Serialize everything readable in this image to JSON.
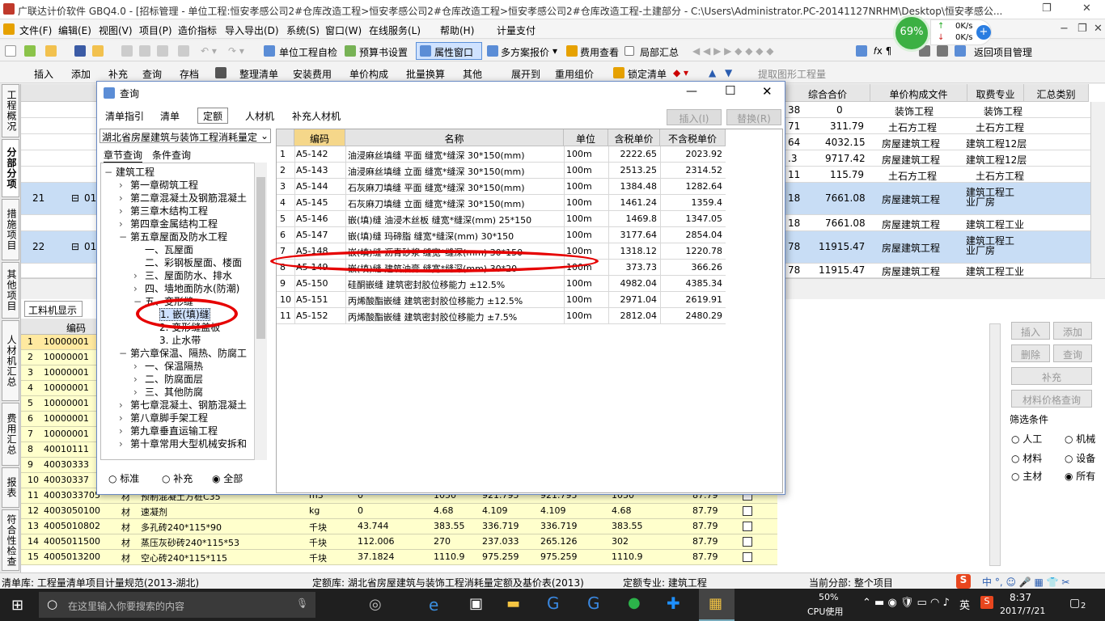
{
  "window": {
    "title": "广联达计价软件 GBQ4.0 - [招标管理 - 单位工程:恒安孝感公司2#仓库改造工程>恒安孝感公司2#仓库改造工程>恒安孝感公司2#仓库改造工程-土建部分 - C:\\Users\\Administrator.PC-20141127NRHM\\Desktop\\恒安孝感公..."
  },
  "menu": [
    "文件(F)",
    "编辑(E)",
    "视图(V)",
    "项目(P)",
    "造价指标",
    "导入导出(D)",
    "系统(S)",
    "窗口(W)",
    "在线服务(L)",
    "帮助(H)",
    "计量支付"
  ],
  "toolbar1": {
    "self_check": "单位工程自检",
    "budget_settings": "预算书设置",
    "property_window": "属性窗口",
    "multi_quote": "多方案报价",
    "fee_view": "费用查看",
    "partial_total": "局部汇总",
    "return_project": "返回项目管理"
  },
  "toolbar2": {
    "insert": "插入",
    "add": "添加",
    "supplement": "补充",
    "query": "查询",
    "save": "存档",
    "organize": "整理清单",
    "install_fee": "安装费用",
    "unit_price": "单价构成",
    "batch_convert": "批量换算",
    "other": "其他",
    "expand_to": "展开到",
    "reuse_price": "重用组价",
    "lock_list": "锁定清单",
    "extract_graphic": "提取图形工程量"
  },
  "network": {
    "percent": "69%",
    "up": "0K/s",
    "down": "0K/s"
  },
  "leftnav": [
    "工程概况",
    "分部分项",
    "措施项目",
    "其他项目",
    "人材机汇总",
    "费用汇总",
    "报表",
    "符合性检查"
  ],
  "main_headers": [
    "综合合价",
    "单价构成文件",
    "取费专业",
    "汇总类别"
  ],
  "main_rows": [
    {
      "num": "",
      "a": "38",
      "total": "0",
      "file": "装饰工程",
      "major": "装饰工程"
    },
    {
      "num": "",
      "a": "71",
      "total": "311.79",
      "file": "土石方工程",
      "major": "土石方工程"
    },
    {
      "num": "",
      "a": "64",
      "total": "4032.15",
      "file": "房屋建筑工程",
      "major": "建筑工程12层"
    },
    {
      "num": "",
      "a": ".3",
      "total": "9717.42",
      "file": "房屋建筑工程",
      "major": "建筑工程12层"
    },
    {
      "num": "",
      "a": "11",
      "total": "115.79",
      "file": "土石方工程",
      "major": "土石方工程"
    },
    {
      "num": "21",
      "a": "18",
      "total": "7661.08",
      "file": "房屋建筑工程",
      "major": "建筑工程工业厂房",
      "code": "010"
    },
    {
      "num": "",
      "a": "18",
      "total": "7661.08",
      "file": "房屋建筑工程",
      "major": "建筑工程工业"
    },
    {
      "num": "22",
      "a": "78",
      "total": "11915.47",
      "file": "房屋建筑工程",
      "major": "建筑工程工业厂房",
      "code": "010"
    },
    {
      "num": "",
      "a": "78",
      "total": "11915.47",
      "file": "房屋建筑工程",
      "major": "建筑工程工业"
    }
  ],
  "lower": {
    "tab": "工料机显示",
    "header_code": "编码",
    "rows": [
      {
        "n": "1",
        "code": "10000001"
      },
      {
        "n": "2",
        "code": "10000001"
      },
      {
        "n": "3",
        "code": "10000001"
      },
      {
        "n": "4",
        "code": "10000001"
      },
      {
        "n": "5",
        "code": "10000001"
      },
      {
        "n": "6",
        "code": "10000001"
      },
      {
        "n": "7",
        "code": "10000001"
      },
      {
        "n": "8",
        "code": "40010111"
      },
      {
        "n": "9",
        "code": "40030333"
      },
      {
        "n": "10",
        "code": "40030337"
      },
      {
        "n": "11",
        "code": "4003033705",
        "type": "材",
        "name": "预制混凝土方桩C35",
        "unit": "m3",
        "q": "0",
        "p1": "1050",
        "p2": "921.795",
        "p3": "921.795",
        "p4": "1050",
        "p5": "87.79"
      },
      {
        "n": "12",
        "code": "4003050100",
        "type": "材",
        "name": "速凝剂",
        "unit": "kg",
        "q": "0",
        "p1": "4.68",
        "p2": "4.109",
        "p3": "4.109",
        "p4": "4.68",
        "p5": "87.79"
      },
      {
        "n": "13",
        "code": "4005010802",
        "type": "材",
        "name": "多孔砖240*115*90",
        "unit": "千块",
        "q": "43.744",
        "p1": "383.55",
        "p2": "336.719",
        "p3": "336.719",
        "p4": "383.55",
        "p5": "87.79"
      },
      {
        "n": "14",
        "code": "4005011500",
        "type": "材",
        "name": "蒸压灰砂砖240*115*53",
        "unit": "千块",
        "q": "112.006",
        "p1": "270",
        "p2": "237.033",
        "p3": "265.126",
        "p4": "302",
        "p5": "87.79"
      },
      {
        "n": "15",
        "code": "4005013200",
        "type": "材",
        "name": "空心砖240*115*115",
        "unit": "千块",
        "q": "37.1824",
        "p1": "1110.9",
        "p2": "975.259",
        "p3": "975.259",
        "p4": "1110.9",
        "p5": "87.79"
      }
    ]
  },
  "rpanel": {
    "insert": "插入",
    "add": "添加",
    "delete": "删除",
    "query": "查询",
    "supplement": "补充",
    "price_query": "材料价格查询",
    "filter_title": "筛选条件",
    "labor": "人工",
    "machine": "机械",
    "material": "材料",
    "equipment": "设备",
    "main_mat": "主材",
    "all": "所有"
  },
  "dialog": {
    "title": "查询",
    "tabs": [
      "清单指引",
      "清单",
      "定额",
      "人材机",
      "补充人材机"
    ],
    "active_tab": "定额",
    "insert_btn": "插入(I)",
    "replace_btn": "替换(R)",
    "library": "湖北省房屋建筑与装饰工程消耗量定",
    "subtabs": [
      "章节查询",
      "条件查询"
    ],
    "tree": [
      {
        "t": "建筑工程",
        "l": 0,
        "e": "−"
      },
      {
        "t": "第一章砌筑工程",
        "l": 1,
        "e": "›"
      },
      {
        "t": "第二章混凝土及钢筋混凝土",
        "l": 1,
        "e": "›"
      },
      {
        "t": "第三章木结构工程",
        "l": 1,
        "e": "›"
      },
      {
        "t": "第四章金属结构工程",
        "l": 1,
        "e": "›"
      },
      {
        "t": "第五章屋面及防水工程",
        "l": 1,
        "e": "−"
      },
      {
        "t": "一、瓦屋面",
        "l": 2,
        "e": ""
      },
      {
        "t": "二、彩钢板屋面、楼面",
        "l": 2,
        "e": ""
      },
      {
        "t": "三、屋面防水、排水",
        "l": 2,
        "e": "›"
      },
      {
        "t": "四、墙地面防水(防潮)",
        "l": 2,
        "e": "›"
      },
      {
        "t": "五、变形缝",
        "l": 2,
        "e": "−"
      },
      {
        "t": "1. 嵌(填)缝",
        "l": 3,
        "e": "",
        "sel": true
      },
      {
        "t": "2. 变形缝盖板",
        "l": 3,
        "e": ""
      },
      {
        "t": "3. 止水带",
        "l": 3,
        "e": ""
      },
      {
        "t": "第六章保温、隔热、防腐工",
        "l": 1,
        "e": "−"
      },
      {
        "t": "一、保温隔热",
        "l": 2,
        "e": "›"
      },
      {
        "t": "二、防腐面层",
        "l": 2,
        "e": "›"
      },
      {
        "t": "三、其他防腐",
        "l": 2,
        "e": "›"
      },
      {
        "t": "第七章混凝土、钢筋混凝土",
        "l": 1,
        "e": "›"
      },
      {
        "t": "第八章脚手架工程",
        "l": 1,
        "e": "›"
      },
      {
        "t": "第九章垂直运输工程",
        "l": 1,
        "e": "›"
      },
      {
        "t": "第十章常用大型机械安拆和",
        "l": 1,
        "e": "›"
      }
    ],
    "radios": [
      "标准",
      "补充",
      "全部"
    ],
    "headers": [
      "编码",
      "名称",
      "单位",
      "含税单价",
      "不含税单价"
    ],
    "rows": [
      {
        "n": "1",
        "code": "A5-142",
        "name": "油浸麻丝填缝 平面 缝宽*缝深 30*150(mm)",
        "unit": "100m",
        "p": "2222.65",
        "q": "2023.92"
      },
      {
        "n": "2",
        "code": "A5-143",
        "name": "油浸麻丝填缝 立面 缝宽*缝深 30*150(mm)",
        "unit": "100m",
        "p": "2513.25",
        "q": "2314.52"
      },
      {
        "n": "3",
        "code": "A5-144",
        "name": "石灰麻刀填缝 平面 缝宽*缝深 30*150(mm)",
        "unit": "100m",
        "p": "1384.48",
        "q": "1282.64"
      },
      {
        "n": "4",
        "code": "A5-145",
        "name": "石灰麻刀填缝 立面 缝宽*缝深 30*150(mm)",
        "unit": "100m",
        "p": "1461.24",
        "q": "1359.4"
      },
      {
        "n": "5",
        "code": "A5-146",
        "name": "嵌(填)缝 油浸木丝板 缝宽*缝深(mm) 25*150",
        "unit": "100m",
        "p": "1469.8",
        "q": "1347.05"
      },
      {
        "n": "6",
        "code": "A5-147",
        "name": "嵌(填)缝 玛碲脂 缝宽*缝深(mm) 30*150",
        "unit": "100m",
        "p": "3177.64",
        "q": "2854.04"
      },
      {
        "n": "7",
        "code": "A5-148",
        "name": "嵌(填)缝 沥青砂浆 缝宽*缝深(mm) 30*150",
        "unit": "100m",
        "p": "1318.12",
        "q": "1220.78"
      },
      {
        "n": "8",
        "code": "A5-149",
        "name": "嵌(填)缝 建筑油膏 缝宽*缝深(mm) 30*20",
        "unit": "100m",
        "p": "373.73",
        "q": "366.26"
      },
      {
        "n": "9",
        "code": "A5-150",
        "name": "硅酮嵌缝 建筑密封胶位移能力 ±12.5%",
        "unit": "100m",
        "p": "4982.04",
        "q": "4385.34"
      },
      {
        "n": "10",
        "code": "A5-151",
        "name": "丙烯酸酯嵌缝 建筑密封胶位移能力 ±12.5%",
        "unit": "100m",
        "p": "2971.04",
        "q": "2619.91"
      },
      {
        "n": "11",
        "code": "A5-152",
        "name": "丙烯酸酯嵌缝 建筑密封胶位移能力 ±7.5%",
        "unit": "100m",
        "p": "2812.04",
        "q": "2480.29"
      }
    ]
  },
  "status": {
    "list_lib": "清单库: 工程量清单项目计量规范(2013-湖北)",
    "quota_lib": "定额库: 湖北省房屋建筑与装饰工程消耗量定额及基价表(2013)",
    "quota_major": "定额专业: 建筑工程",
    "current_part": "当前分部: 整个项目"
  },
  "taskbar": {
    "search": "在这里输入你要搜索的内容",
    "cpu_pct": "50%",
    "cpu_label": "CPU使用",
    "ime": "英",
    "time": "8:37",
    "date": "2017/7/21",
    "notif": "2"
  }
}
